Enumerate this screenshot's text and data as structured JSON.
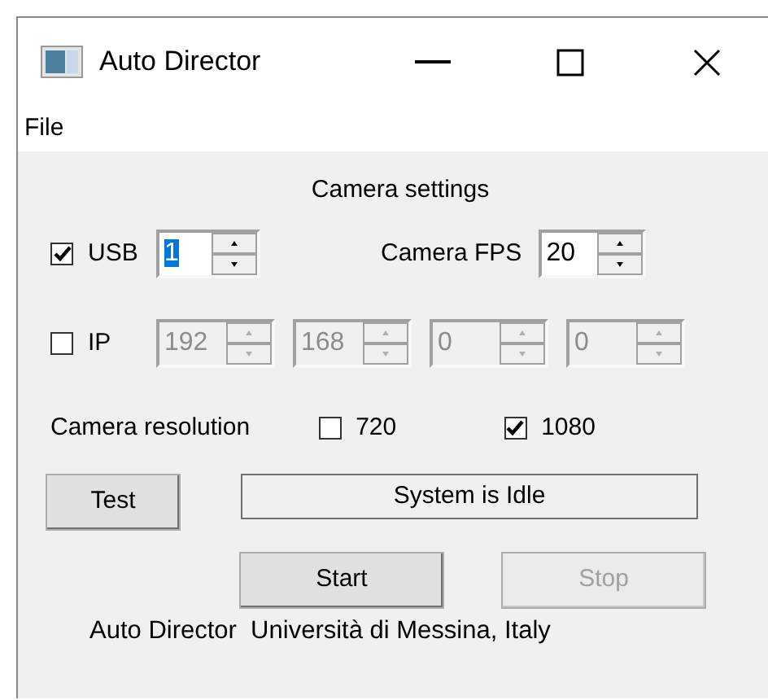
{
  "window": {
    "title": "Auto Director"
  },
  "menu": [
    {
      "label": "File"
    }
  ],
  "section_title": "Camera settings",
  "usb": {
    "label": "USB",
    "checked": true,
    "value": "1",
    "focused": true
  },
  "fps": {
    "label": "Camera FPS",
    "value": "20"
  },
  "ip": {
    "label": "IP",
    "checked": false,
    "disabled": true,
    "octets": [
      "192",
      "168",
      "0",
      "0"
    ]
  },
  "resolution": {
    "label": "Camera resolution",
    "options": [
      {
        "label": "720",
        "checked": false
      },
      {
        "label": "1080",
        "checked": true
      }
    ]
  },
  "test_button": {
    "label": "Test"
  },
  "status": "System is Idle",
  "buttons": [
    {
      "label": "Start",
      "disabled": false
    },
    {
      "label": "Stop",
      "disabled": true
    }
  ],
  "footer": "Auto Director  Università di Messina, Italy"
}
